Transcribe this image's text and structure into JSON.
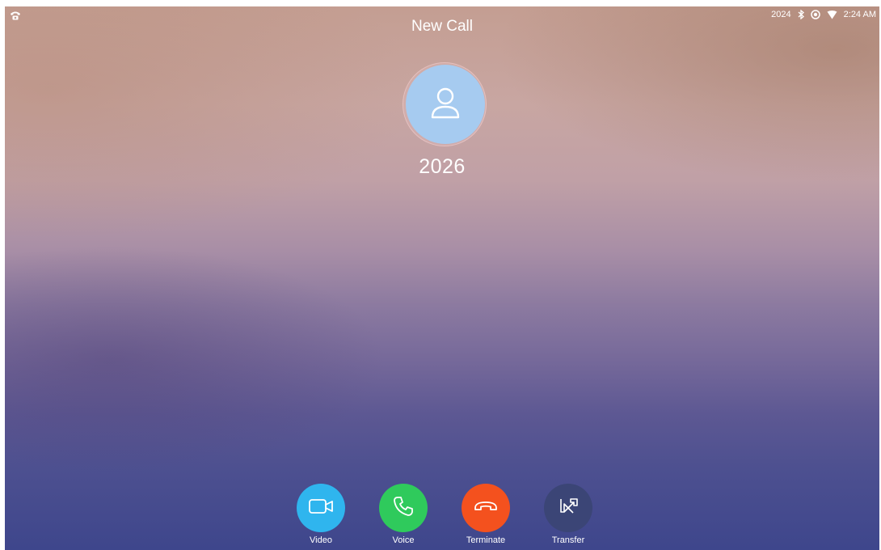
{
  "status_bar": {
    "left_icon": "phone-icon",
    "account": "2024",
    "icons": [
      "bluetooth-icon",
      "target-icon",
      "wifi-icon"
    ],
    "time": "2:24 AM"
  },
  "call": {
    "title": "New Call",
    "avatar_icon": "person-icon",
    "number": "2026"
  },
  "actions": {
    "video": {
      "label": "Video",
      "icon": "video-camera-icon",
      "color": "#2fb5ee"
    },
    "voice": {
      "label": "Voice",
      "icon": "phone-handset-icon",
      "color": "#2fca5c"
    },
    "terminate": {
      "label": "Terminate",
      "icon": "hang-up-icon",
      "color": "#f4511e"
    },
    "transfer": {
      "label": "Transfer",
      "icon": "transfer-icon",
      "color": "#3b4576"
    }
  },
  "colors": {
    "avatar": "#a6cbf0",
    "text": "#ffffff"
  }
}
